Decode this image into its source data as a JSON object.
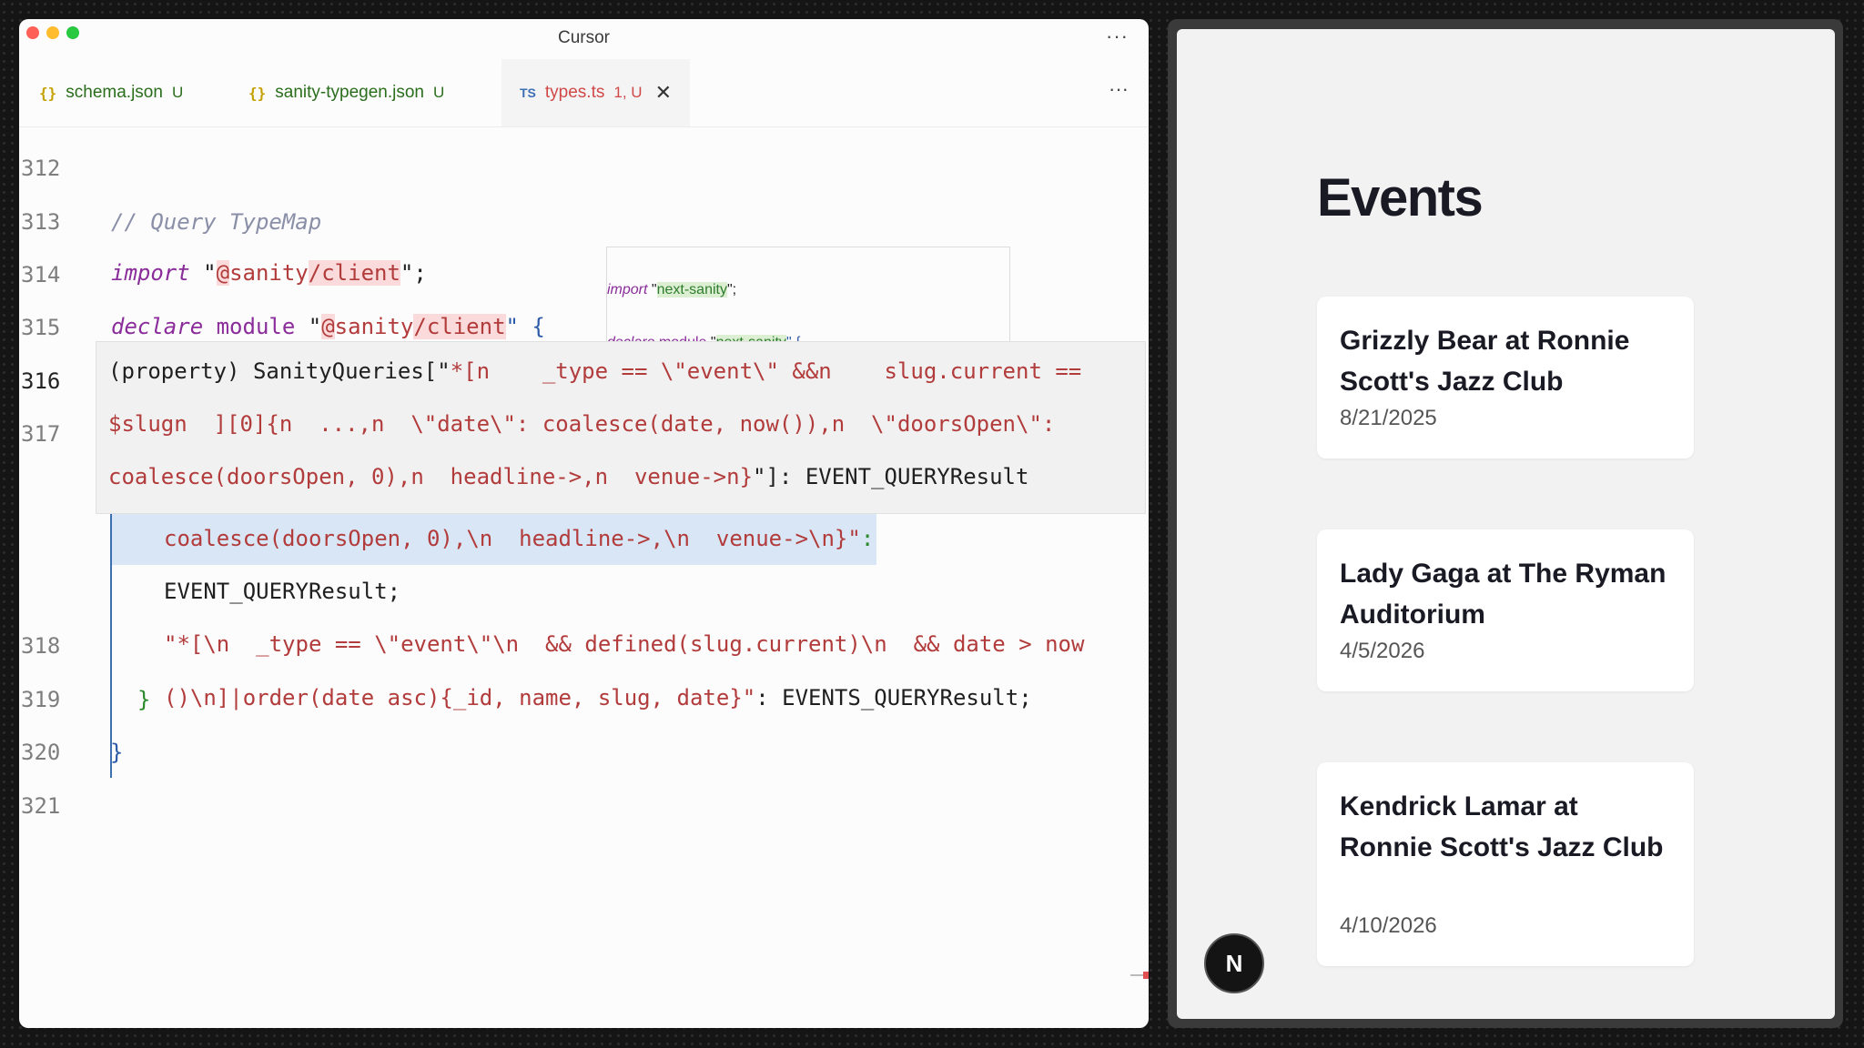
{
  "window": {
    "title": "Cursor"
  },
  "tabs": [
    {
      "icon": "{}",
      "name": "schema.json",
      "status": "U"
    },
    {
      "icon": "{}",
      "name": "sanity-typegen.json",
      "status": "U"
    },
    {
      "icon": "TS",
      "name": "types.ts",
      "status": "1, U"
    }
  ],
  "code": {
    "line_numbers": [
      "312",
      "313",
      "314",
      "315",
      "316",
      "317",
      "318",
      "319",
      "320",
      "321"
    ],
    "l313": "// Query TypeMap",
    "l314": {
      "kw": "import",
      "q1": "\"",
      "a": "@",
      "b": "sanity",
      "c": "/client",
      "q2": "\";"
    },
    "l315": {
      "kw": "declare",
      "mod": "module",
      "q1": "\"",
      "a": "@",
      "b": "sanity",
      "c": "/client",
      "q2": "\" {"
    },
    "sel_line": "coalesce(doorsOpen, 0),\\n  headline->,\\n  venue->\\n}\"",
    "sel_colon": ":",
    "result_line": "EVENT_QUERYResult;",
    "l318a": "\"*[\\n  _type == \\\"event\\\"\\n  && defined(slug.current)\\n  && date > now",
    "l318b_str": "()\\n]|order(date asc){_id, name, slug, date}\"",
    "l318b_rest": ": EVENTS_QUERYResult;",
    "l319": "}",
    "l320": "}"
  },
  "peek": {
    "l1": {
      "kw": "import",
      "q1": "\"",
      "mod": "next-sanity",
      "q2": "\";"
    },
    "l2": {
      "kw": "declare",
      "mod": "module",
      "q1": "\"",
      "name": "next-sanity",
      "q2": "\" {"
    }
  },
  "hover": {
    "l1a": "(property) SanityQueries[\"",
    "l1b": "*[n    _type == \\\"event\\\" &&n    slug.current ==",
    "l2": "$slugn  ][0]{n  ...,n  \\\"date\\\": coalesce(date, now()),n  \\\"doorsOpen\\\":",
    "l3a": "coalesce(doorsOpen, 0),n  headline->,n  venue->n}",
    "l3b": "\"]: EVENT_QUERYResult"
  },
  "preview": {
    "heading": "Events",
    "events": [
      {
        "name": "Grizzly Bear at Ronnie Scott's Jazz Club",
        "date": "8/21/2025"
      },
      {
        "name": "Lady Gaga at The Ryman Auditorium",
        "date": "4/5/2026"
      },
      {
        "name": "Kendrick Lamar at Ronnie Scott's Jazz Club",
        "date": "4/10/2026"
      }
    ],
    "badge": "N"
  }
}
